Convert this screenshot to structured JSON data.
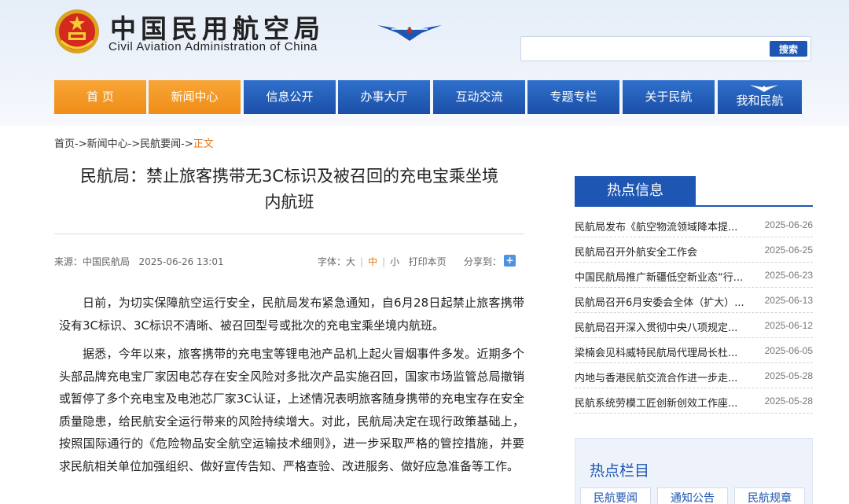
{
  "site": {
    "name_cn": "中国民用航空局",
    "name_en": "Civil Aviation Administration of China"
  },
  "search": {
    "placeholder": "",
    "button": "搜索"
  },
  "nav": [
    "首 页",
    "新闻中心",
    "信息公开",
    "办事大厅",
    "互动交流",
    "专题专栏",
    "关于民航",
    "我和民航"
  ],
  "breadcrumb": {
    "path": "首页->新闻中心->民航要闻->",
    "current": "正文"
  },
  "article": {
    "title_line1": "民航局：禁止旅客携带无3C标识及被召回的充电宝乘坐境",
    "title_line2": "内航班",
    "source": "来源：中国民航局",
    "datetime": "2025-06-26 13:01",
    "font_label": "字体：",
    "font_large": "大",
    "font_medium": "中",
    "font_small": "小",
    "print": "打印本页",
    "share": "分享到：",
    "paragraphs": [
      "日前，为切实保障航空运行安全，民航局发布紧急通知，自6月28日起禁止旅客携带没有3C标识、3C标识不清晰、被召回型号或批次的充电宝乘坐境内航班。",
      "据悉，今年以来，旅客携带的充电宝等锂电池产品机上起火冒烟事件多发。近期多个头部品牌充电宝厂家因电芯存在安全风险对多批次产品实施召回，国家市场监管总局撤销或暂停了多个充电宝及电池芯厂家3C认证，上述情况表明旅客随身携带的充电宝存在安全质量隐患，给民航安全运行带来的风险持续增大。对此，民航局决定在现行政策基础上，按照国际通行的《危险物品安全航空运输技术细则》，进一步采取严格的管控措施，并要求民航相关单位加强组织、做好宣传告知、严格查验、改进服务、做好应急准备等工作。"
    ]
  },
  "hot_info": {
    "title": "热点信息",
    "items": [
      {
        "text": "民航局发布《航空物流领域降本提...",
        "date": "2025-06-26"
      },
      {
        "text": "民航局召开外航安全工作会",
        "date": "2025-06-25"
      },
      {
        "text": "中国民航局推广新疆低空新业态“行...",
        "date": "2025-06-23"
      },
      {
        "text": "民航局召开6月安委会全体（扩大）...",
        "date": "2025-06-13"
      },
      {
        "text": "民航局召开深入贯彻中央八项规定...",
        "date": "2025-06-12"
      },
      {
        "text": "梁楠会见科威特民航局代理局长杜...",
        "date": "2025-06-05"
      },
      {
        "text": "内地与香港民航交流合作进一步走...",
        "date": "2025-05-28"
      },
      {
        "text": "民航系统劳模工匠创新创效工作座...",
        "date": "2025-05-28"
      }
    ]
  },
  "hot_columns": {
    "title": "热点栏目",
    "tabs": [
      "民航要闻",
      "通知公告",
      "民航规章"
    ]
  },
  "colors": {
    "primary_blue": "#1e56b3",
    "orange": "#ef8d17"
  }
}
